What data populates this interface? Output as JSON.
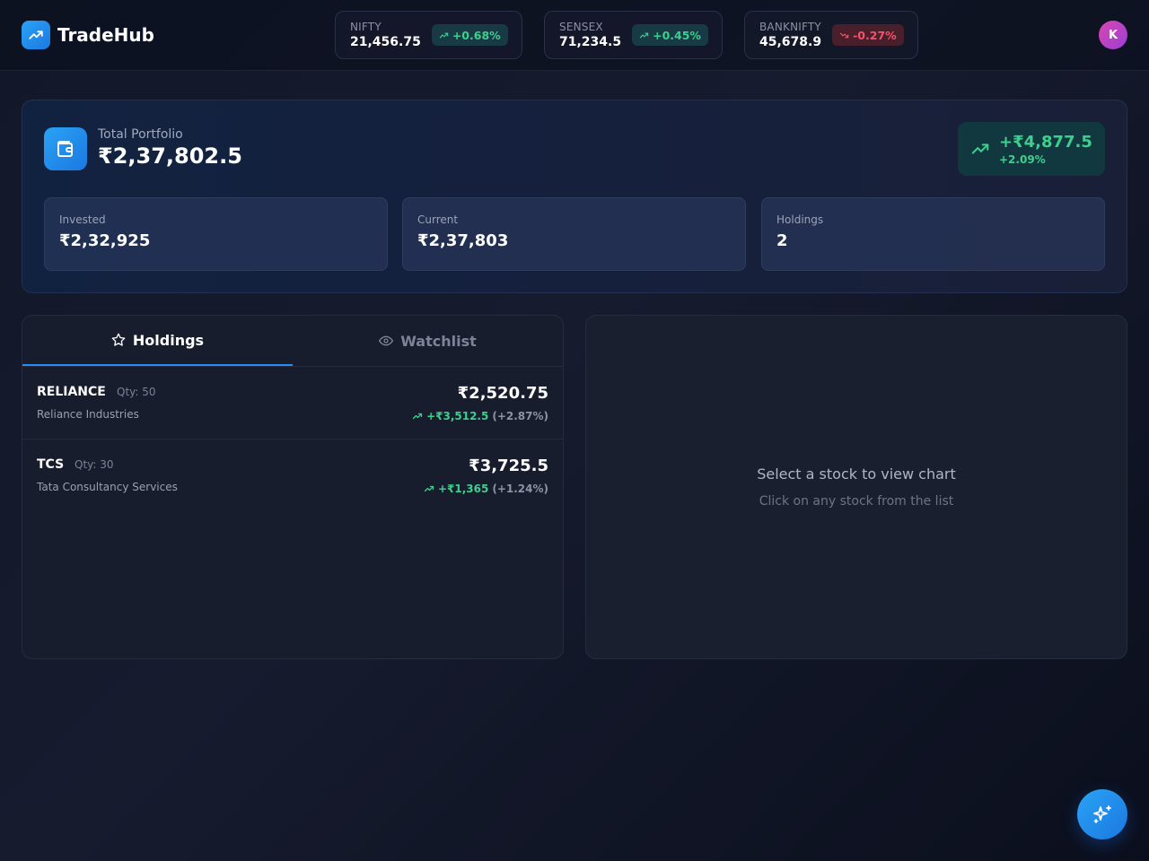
{
  "header": {
    "brand_name": "TradeHub",
    "avatar_initial": "K",
    "indices": [
      {
        "name": "NIFTY",
        "value": "21,456.75",
        "change": "+0.68%",
        "direction": "up"
      },
      {
        "name": "SENSEX",
        "value": "71,234.5",
        "change": "+0.45%",
        "direction": "up"
      },
      {
        "name": "BANKNIFTY",
        "value": "45,678.9",
        "change": "-0.27%",
        "direction": "down"
      }
    ]
  },
  "portfolio": {
    "label": "Total Portfolio",
    "value": "₹2,37,802.5",
    "gain": "+₹4,877.5",
    "gain_pct": "+2.09%",
    "stats": [
      {
        "label": "Invested",
        "value": "₹2,32,925"
      },
      {
        "label": "Current",
        "value": "₹2,37,803"
      },
      {
        "label": "Holdings",
        "value": "2"
      }
    ]
  },
  "tabs": [
    {
      "label": "Holdings",
      "icon": "star-icon",
      "active": true
    },
    {
      "label": "Watchlist",
      "icon": "eye-icon",
      "active": false
    }
  ],
  "holdings": [
    {
      "symbol": "RELIANCE",
      "qty": "Qty: 50",
      "name": "Reliance Industries",
      "price": "₹2,520.75",
      "change": "+₹3,512.5",
      "change_pct": "(+2.87%)"
    },
    {
      "symbol": "TCS",
      "qty": "Qty: 30",
      "name": "Tata Consultancy Services",
      "price": "₹3,725.5",
      "change": "+₹1,365",
      "change_pct": "(+1.24%)"
    }
  ],
  "chart_panel": {
    "title": "Select a stock to view chart",
    "subtitle": "Click on any stock from the list"
  },
  "colors": {
    "accent": "#2a8cf0",
    "positive": "#3ecf8e",
    "negative": "#f0546b",
    "avatar": "#c445c4"
  }
}
